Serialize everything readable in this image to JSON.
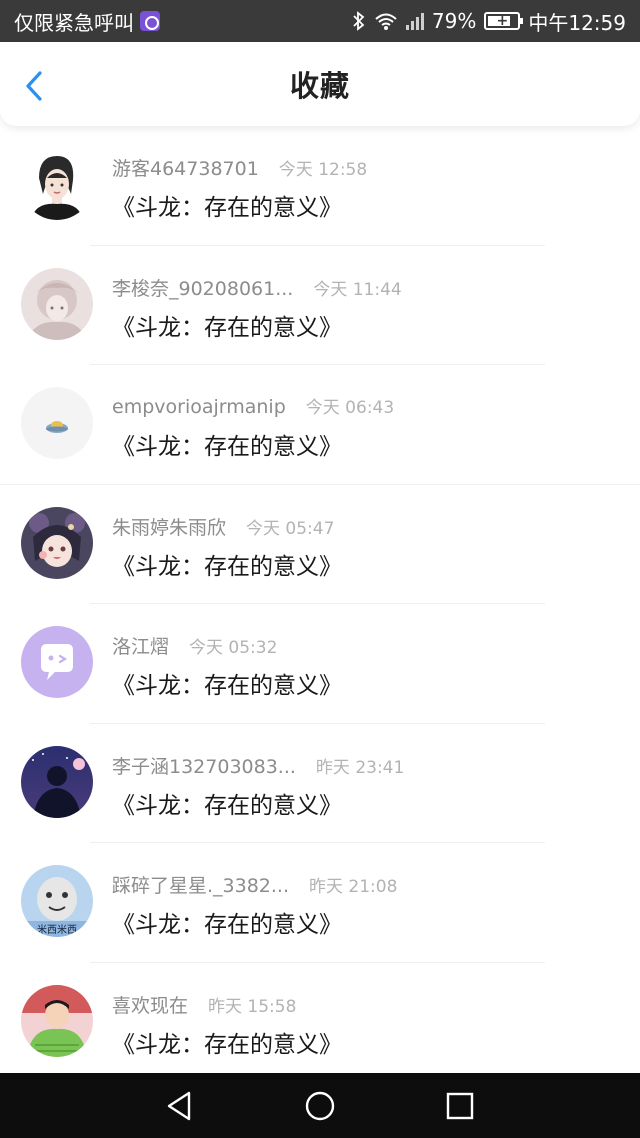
{
  "status_bar": {
    "left_text": "仅限紧急呼叫",
    "battery_text": "79%",
    "battery_level": 0.79,
    "time": "中午12:59"
  },
  "header": {
    "title": "收藏"
  },
  "items": [
    {
      "username": "游客464738701",
      "time": "今天 12:58",
      "title": "《斗龙：存在的意义》"
    },
    {
      "username": "李梭奈_90208061...",
      "time": "今天 11:44",
      "title": "《斗龙：存在的意义》"
    },
    {
      "username": "empvorioajrmanip",
      "time": "今天 06:43",
      "title": "《斗龙：存在的意义》"
    },
    {
      "username": "朱雨婷朱雨欣",
      "time": "今天 05:47",
      "title": "《斗龙：存在的意义》"
    },
    {
      "username": "洛江熠",
      "time": "今天 05:32",
      "title": "《斗龙：存在的意义》"
    },
    {
      "username": "李子涵132703083...",
      "time": "昨天 23:41",
      "title": "《斗龙：存在的意义》"
    },
    {
      "username": "踩碎了星星._3382...",
      "time": "昨天 21:08",
      "title": "《斗龙：存在的意义》"
    },
    {
      "username": "喜欢现在",
      "time": "昨天 15:58",
      "title": "《斗龙：存在的意义》"
    }
  ],
  "avatar_8_text": "米西米西",
  "colors": {
    "accent": "#2b8fef",
    "status_bar": "#3a3a3a",
    "nav_bar": "#0d0d0d"
  }
}
